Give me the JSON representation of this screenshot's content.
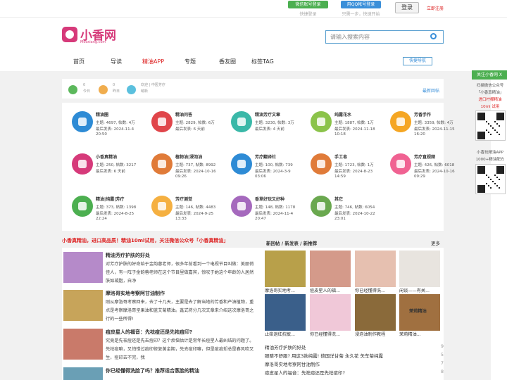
{
  "top": {
    "wechat_login": "微信账号登录",
    "wechat_sub": "快捷登录",
    "qq_login": "用QQ帐号登录",
    "qq_sub": "只需一步，快速开始",
    "login": "登录",
    "register": "立即注册"
  },
  "brand": {
    "name": "小香网",
    "domain": "Mooxiang.com",
    "color": "#d63a7a"
  },
  "search": {
    "placeholder": "请输入搜索内容"
  },
  "nav": {
    "items": [
      "首页",
      "导读",
      "精油APP",
      "专题",
      "香友圈",
      "标签TAG"
    ],
    "active": "精油APP",
    "quick": "快捷导航"
  },
  "stats": [
    {
      "value": "0",
      "label": "今日"
    },
    {
      "value": "0",
      "label": "昨日"
    },
    {
      "value": "",
      "label": "欢迎 | 中医芳疗"
    },
    {
      "value": "",
      "label": "萌新"
    }
  ],
  "latest_reply": "最新回帖",
  "forums": [
    {
      "name": "精油圈",
      "topics": "主题: 4697, 帖数: 4万",
      "latest": "最后发表: 2024-11-4",
      "time": "20:50",
      "color": "#2e8bd5"
    },
    {
      "name": "精油问答",
      "topics": "主题: 2829, 帖数: 6万",
      "latest": "最后发表: 6 天前",
      "time": "",
      "color": "#e0454a"
    },
    {
      "name": "精油芳疗文章",
      "topics": "主题: 3230, 帖数: 3万",
      "latest": "最后发表: 4 天前",
      "time": "",
      "color": "#3ab8a8"
    },
    {
      "name": "纯露花水",
      "topics": "主题: 1887, 帖数: 1万",
      "latest": "最后发表: 2024-11-18",
      "time": "10:18",
      "color": "#8bc34a"
    },
    {
      "name": "芳香手作",
      "topics": "主题: 3359, 帖数: 4万",
      "latest": "最后发表: 2024-11-15",
      "time": "16:20",
      "color": "#f5a623"
    },
    {
      "name": "小香真精油",
      "topics": "主题: 250, 帖数: 3217",
      "latest": "最后发表: 6 天前",
      "time": "",
      "color": "#d63a7a"
    },
    {
      "name": "植物油|浸泡油",
      "topics": "主题: 737, 帖数: 8992",
      "latest": "最后发表: 2024-10-16",
      "time": "09:26",
      "color": "#e07b39"
    },
    {
      "name": "芳疗翻译社",
      "topics": "主题: 100, 帖数: 739",
      "latest": "最后发表: 2024-3-9",
      "time": "03:06",
      "color": "#2e8bd5"
    },
    {
      "name": "手工皂",
      "topics": "主题: 1723, 帖数: 1万",
      "latest": "最后发表: 2024-8-23",
      "time": "14:59",
      "color": "#e07b39"
    },
    {
      "name": "芳疗直视频",
      "topics": "主题: 426, 帖数: 6018",
      "latest": "最后发表: 2024-10-16",
      "time": "09:29",
      "color": "#f06292"
    },
    {
      "name": "精油|纯露|芳疗",
      "topics": "主题: 373, 帖数: 1398",
      "latest": "最后发表: 2024-8-25",
      "time": "22:24",
      "color": "#4caf50"
    },
    {
      "name": "芳疗测觉",
      "topics": "主题: 146, 帖数: 4483",
      "latest": "最后发表: 2024-9-25",
      "time": "13:33",
      "color": "#f5b041"
    },
    {
      "name": "香草好玩又好种",
      "topics": "主题: 148, 帖数: 1178",
      "latest": "最后发表: 2024-11-4",
      "time": "20:47",
      "color": "#a569bd"
    },
    {
      "name": "其它",
      "topics": "主题: 746, 帖数: 6054",
      "latest": "最后发表: 2024-10-22",
      "time": "23:01",
      "color": "#6aa84f"
    }
  ],
  "notice": "小香真精油，进口高品质！精油10ml试用，关注微信公众号「小香真精油」",
  "articles": [
    {
      "title": "精油芳疗护肤的好处",
      "desc": "对芳疗护肤的好奇始于金韵蓉老师，很多年前看到一个电视节目叫做：美丽俏佳人，有一阵子金韵蓉老师在这个节目里做嘉宾，惊叹于她这个年龄的人居然肤如凝脂，白净",
      "color": "#b58ac9"
    },
    {
      "title": "摩洛哥实地考察阿甘油制作",
      "desc": "刚从摩洛哥考察回来，去了十几天，主要是去了解当地的芳香和产油植物，重点是考察摩洛哥坚果油和蓝艾菊精油。鑫式将分几次文章来介绍这次摩洛哥之行的一些所得!",
      "color": "#c7a45a"
    },
    {
      "title": "痘皮星人的福音：先祛痘还是先祛痘印?",
      "desc": "究竟是先祛痘还是先去痘印？这个烦恼估计是常年长痘星人最纠结的问题了。先祛痘嘛，又怕错过痘印修复黄金期，先去痘印嘛，但是痘痘却总是春风吹又生，痘印去不完，我",
      "color": "#c97a6a"
    },
    {
      "title": "你已经懂得洗脸了吗？推荐适合蒸脸的精油",
      "desc": "",
      "color": "#6a9fb5"
    }
  ],
  "new_tabs": "新回帖 / 新发表 / 新推荐",
  "more": "更多",
  "thumbs": [
    {
      "caption": "摩洛哥实地考...",
      "color": "#b8a04a"
    },
    {
      "caption": "痘皮星人的福...",
      "color": "#d49a8a"
    },
    {
      "caption": "你已经懂得洗...",
      "color": "#e6c0b0"
    },
    {
      "caption": "闲谈——有关...",
      "color": "#e8e4df"
    },
    {
      "caption": "止痒退红抗敏...",
      "color": "#3a5f8a"
    },
    {
      "caption": "你已经懂得洗...",
      "color": "#f0c8d8"
    },
    {
      "caption": "浸泡油制作教程",
      "color": "#8a6a3a"
    },
    {
      "caption": "茉莉精油...",
      "color": "#a07040"
    }
  ],
  "thumb_extra": "茉莉精油",
  "latest_list": [
    {
      "title": "精油芳疗护肤的好处",
      "num": "9"
    },
    {
      "title": "眼睛不舒服? 用这3款纯露! 德国洋甘菊 永久花 矢车菊纯露",
      "num": "5"
    },
    {
      "title": "摩洛哥实地考察阿甘油制作",
      "num": "7"
    },
    {
      "title": "痘皮星人的福音：先祛痘还是先祛痘印?",
      "num": "8"
    }
  ],
  "side": {
    "header": "关注小香网",
    "close": "X",
    "text1": "扫描微信公众号",
    "text2": "「小香真精油」",
    "text3": "进口柠檬精油",
    "text4": "10ml 试用",
    "text5": "小香玩精油APP",
    "text6": "1000+精油配方"
  }
}
